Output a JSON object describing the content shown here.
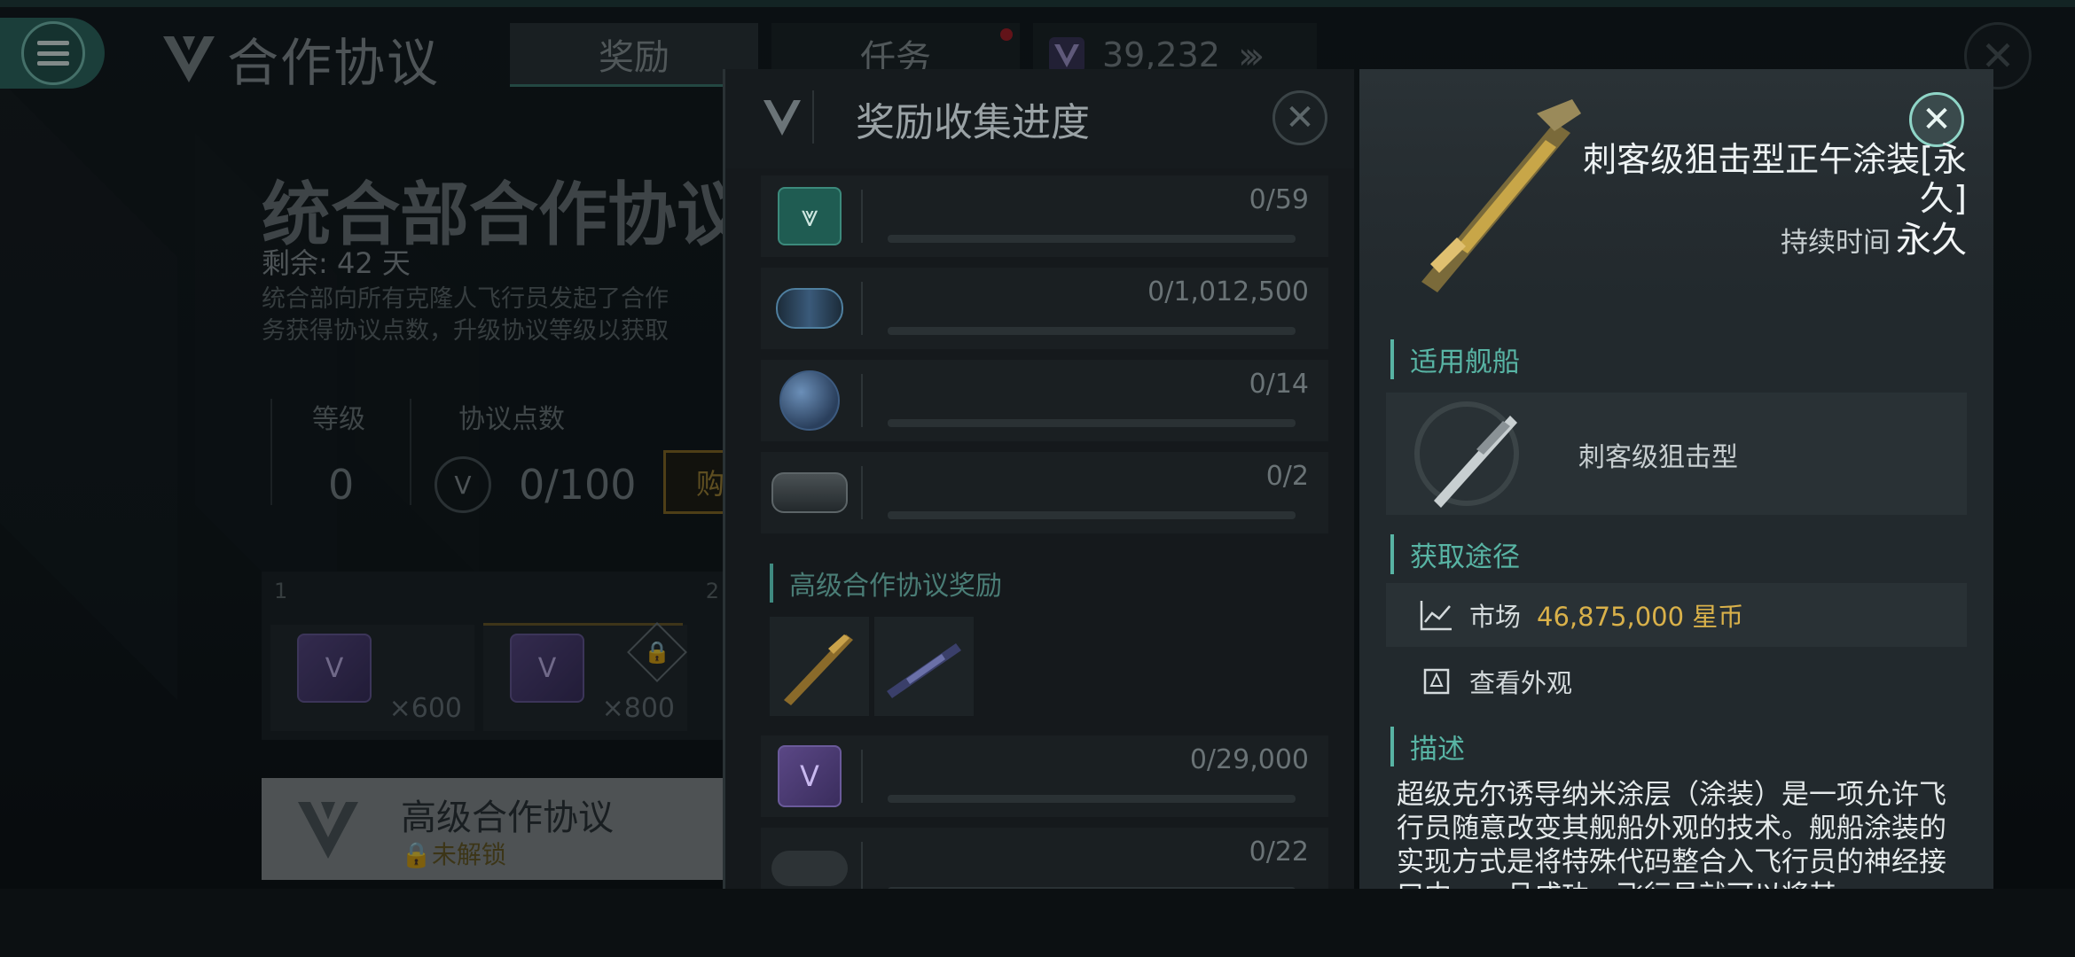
{
  "header": {
    "app_title": "合作协议",
    "tabs": [
      {
        "label": "奖励",
        "active": true
      },
      {
        "label": "任务",
        "active": false,
        "has_notification": true
      }
    ],
    "points_value": "39,232"
  },
  "background_page": {
    "heading": "统合部合作协议",
    "remaining": "剩余: 42 天",
    "description_lines": [
      "统合部向所有克隆人飞行员发起了合作",
      "务获得协议点数，升级协议等级以获取"
    ],
    "level_label": "等级",
    "level_value": "0",
    "points_label": "协议点数",
    "points_value": "0/100",
    "buy_label": "购",
    "reward_strip": {
      "index_1": "1",
      "index_2": "2",
      "cards": [
        {
          "qty": "×600"
        },
        {
          "qty": "×800"
        }
      ]
    },
    "advanced_bar": {
      "title": "高级合作协议",
      "lock_text": "未解锁"
    }
  },
  "progress_panel": {
    "title": "奖励收集进度",
    "rows": [
      {
        "icon": "shield-token-icon",
        "value": "0/59",
        "progress": 0
      },
      {
        "icon": "canister-icon",
        "value": "0/1,012,500",
        "progress": 0
      },
      {
        "icon": "sphere-icon",
        "value": "0/14",
        "progress": 0
      },
      {
        "icon": "chip-icon",
        "value": "0/2",
        "progress": 0
      }
    ],
    "section_title": "高级合作协议奖励",
    "lower_rows": [
      {
        "icon": "purple-token-icon",
        "value": "0/29,000",
        "progress": 0
      },
      {
        "icon": "rock-icon",
        "value": "0/22",
        "progress": 0
      }
    ]
  },
  "detail_panel": {
    "item_name": "刺客级狙击型正午涂装[永久]",
    "duration_label": "持续时间",
    "duration_value": "永久",
    "section_ship": "适用舰船",
    "ship_name": "刺客级狙击型",
    "section_source": "获取途径",
    "market_label": "市场",
    "market_price": "46,875,000 星币",
    "view_label": "查看外观",
    "section_desc": "描述",
    "description": "超级克尔诱导纳米涂层（涂装）是一项允许飞行员随意改变其舰船外观的技术。舰船涂装的实现方式是将特殊代码整合入飞行员的神经接口中，一旦成功，飞行员就可以将其"
  },
  "colors": {
    "accent": "#58b4a4",
    "price": "#d9b14a",
    "menu": "#2e6a61",
    "notification": "#b01c25"
  }
}
